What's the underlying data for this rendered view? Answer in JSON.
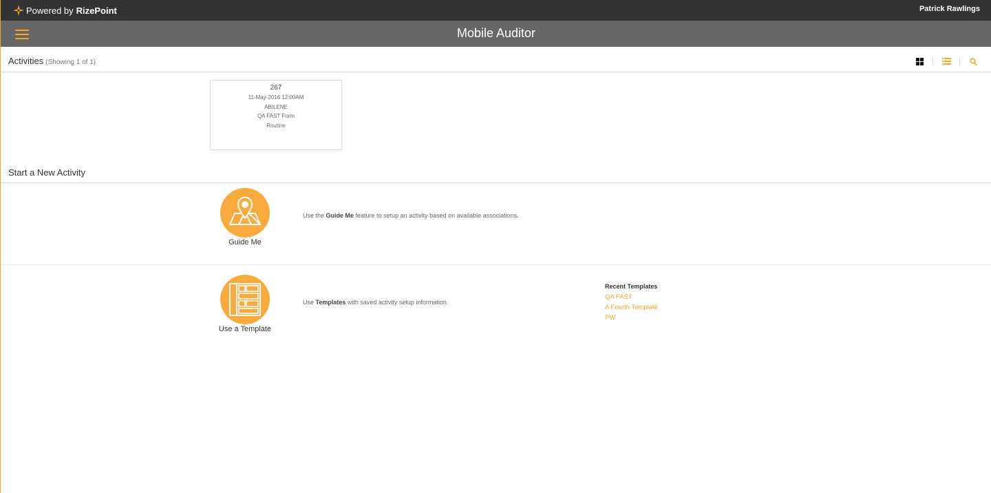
{
  "topbar": {
    "brand_prefix": "Powered by",
    "brand_name": "RizePoint",
    "user_name": "Patrick Rawlings"
  },
  "titlebar": {
    "title": "Mobile Auditor",
    "menu_icon": "hamburger-menu-icon"
  },
  "activities": {
    "title": "Activities",
    "count": "(Showing 1 of 1)",
    "tools": [
      "grid-view-icon",
      "list-view-icon",
      "search-icon"
    ],
    "cards": [
      {
        "id": "267",
        "date": "11-May-2016 12:00AM",
        "location": "ABILENE",
        "form": "QA FAST Form",
        "type": "Routine"
      }
    ]
  },
  "new_activity": {
    "title": "Start a New Activity",
    "guide_me": {
      "label": "Guide Me",
      "icon": "map-pin-icon",
      "desc_pre": "Use the ",
      "desc_bold": "Guide Me",
      "desc_post": " feature to setup an activity based on available associations."
    },
    "template": {
      "label": "Use a Template",
      "icon": "template-layout-icon",
      "desc_pre": "Use ",
      "desc_bold": "Templates",
      "desc_post": " with saved activity setup information."
    },
    "recent_templates": {
      "title": "Recent Templates",
      "items": [
        "QA FAST",
        "A Fourth Template",
        "PW"
      ]
    }
  },
  "colors": {
    "accent": "#f5a623",
    "topbar": "#333333",
    "titlebar": "#666666"
  }
}
